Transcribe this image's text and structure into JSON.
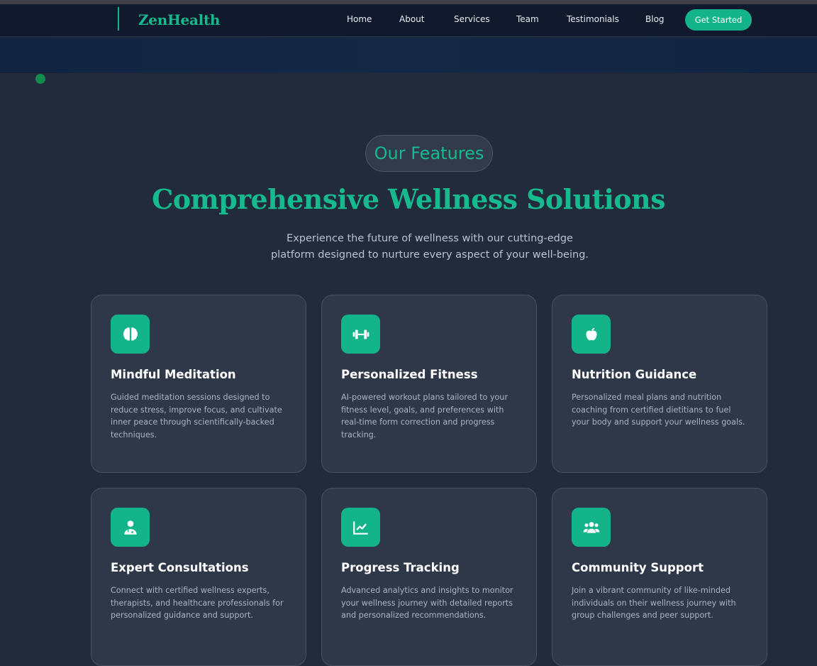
{
  "brand": {
    "name": "ZenHealth"
  },
  "nav": {
    "items": [
      {
        "label": "Home"
      },
      {
        "label": "About"
      },
      {
        "label": "Services"
      },
      {
        "label": "Team"
      },
      {
        "label": "Testimonials"
      },
      {
        "label": "Blog"
      }
    ],
    "cta_label": "Get Started"
  },
  "features": {
    "badge": "Our Features",
    "title": "Comprehensive Wellness Solutions",
    "subtitle": "Experience the future of wellness with our cutting-edge platform designed to nurture every aspect of your well-being.",
    "cards": [
      {
        "icon": "brain-icon",
        "title": "Mindful Meditation",
        "description": "Guided meditation sessions designed to reduce stress, improve focus, and cultivate inner peace through scientifically-backed techniques."
      },
      {
        "icon": "dumbbell-icon",
        "title": "Personalized Fitness",
        "description": "AI-powered workout plans tailored to your fitness level, goals, and preferences with real-time form correction and progress tracking."
      },
      {
        "icon": "apple-icon",
        "title": "Nutrition Guidance",
        "description": "Personalized meal plans and nutrition coaching from certified dietitians to fuel your body and support your wellness goals."
      },
      {
        "icon": "doctor-icon",
        "title": "Expert Consultations",
        "description": "Connect with certified wellness experts, therapists, and healthcare professionals for personalized guidance and support."
      },
      {
        "icon": "chart-line-icon",
        "title": "Progress Tracking",
        "description": "Advanced analytics and insights to monitor your wellness journey with detailed reports and personalized recommendations."
      },
      {
        "icon": "users-icon",
        "title": "Community Support",
        "description": "Join a vibrant community of like-minded individuals on their wellness journey with group challenges and peer support."
      }
    ]
  },
  "colors": {
    "accent": "#14b48a",
    "background": "#212b3b",
    "navbar": "#111a2c",
    "card": "#2f3849"
  }
}
